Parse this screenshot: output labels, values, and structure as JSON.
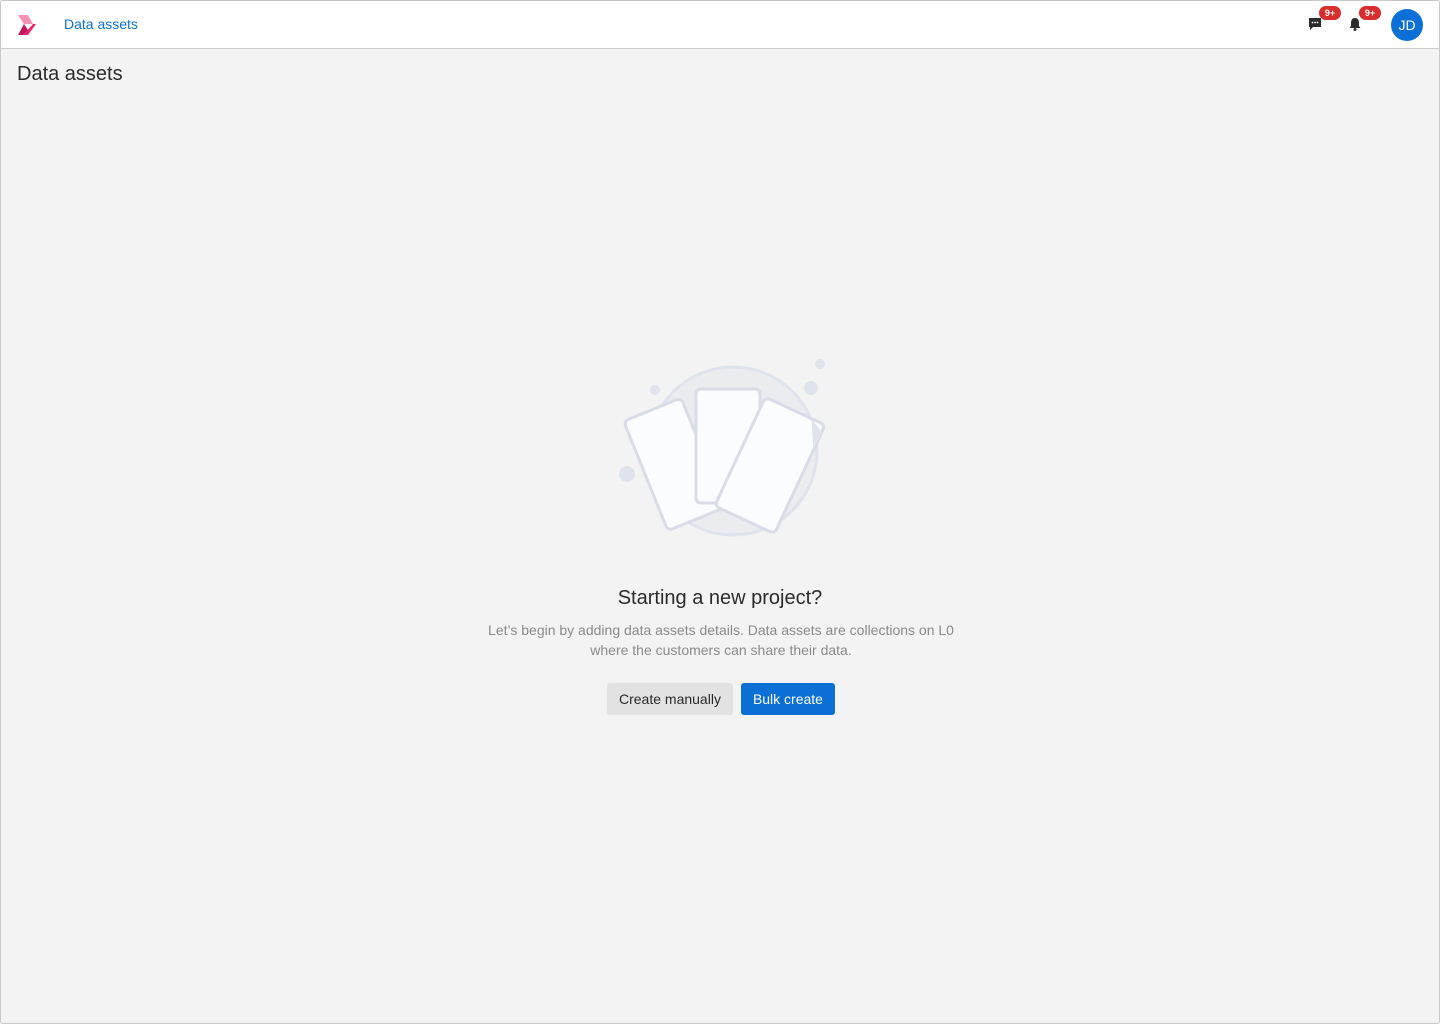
{
  "header": {
    "breadcrumb": "Data assets",
    "messages_badge": "9+",
    "notifications_badge": "9+",
    "avatar_initials": "JD"
  },
  "page": {
    "title": "Data assets"
  },
  "empty_state": {
    "title": "Starting a new project?",
    "description_line1": "Let’s begin by adding data assets details. Data assets are collections on L0",
    "description_line2": "where the customers can share their data.",
    "create_manually_label": "Create manually",
    "bulk_create_label": "Bulk create"
  },
  "colors": {
    "accent": "#0b6fd6",
    "badge": "#d92c2c",
    "logo_pink": "#e8266f"
  }
}
